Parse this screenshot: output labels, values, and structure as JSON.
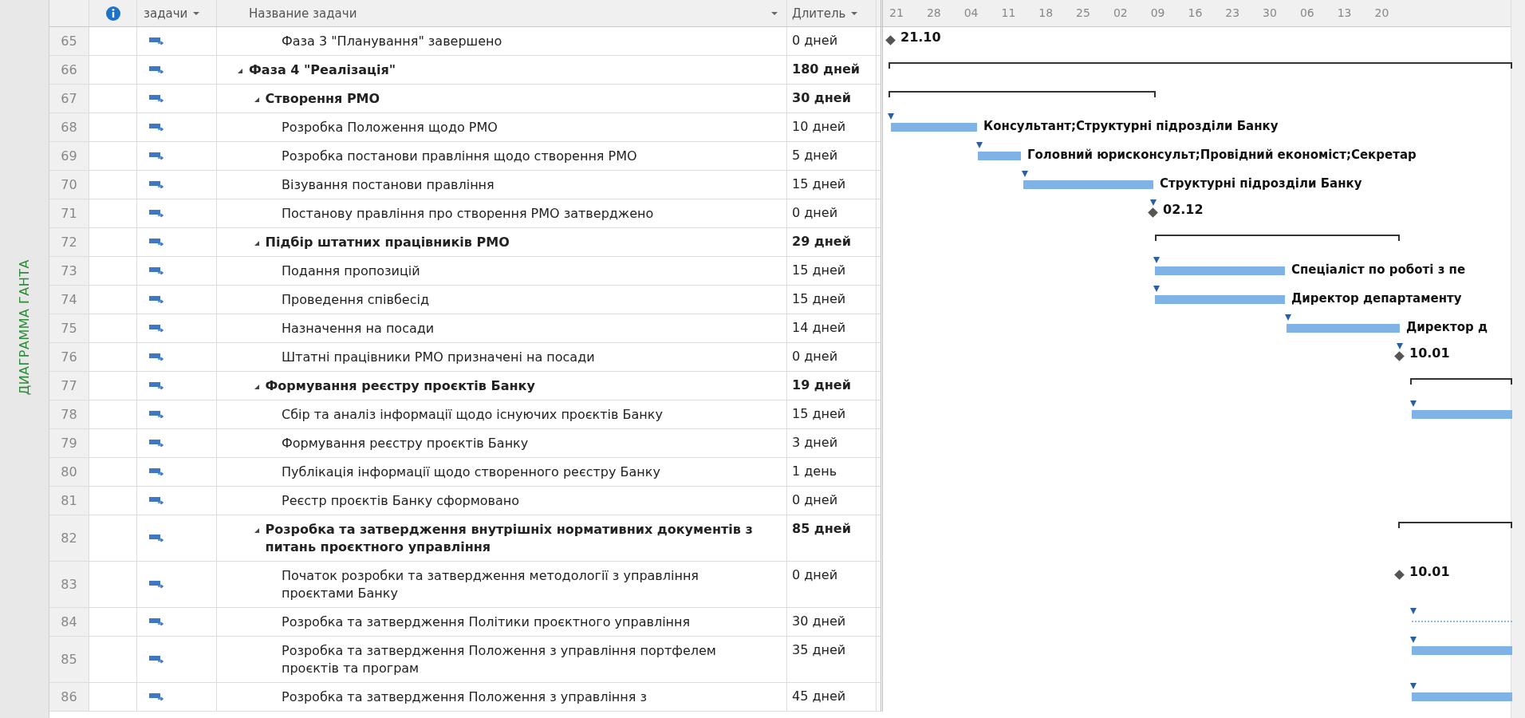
{
  "side_label": "ДИАГРАММА ГАНТА",
  "columns": {
    "mode": "задачи",
    "name": "Название задачи",
    "duration": "Длитель"
  },
  "timescale": [
    "21",
    "28",
    "04",
    "11",
    "18",
    "25",
    "02",
    "09",
    "16",
    "23",
    "30",
    "06",
    "13",
    "20"
  ],
  "tasks": [
    {
      "children": [
        {
          "children": [
            {
              "id": "65",
              "name": "Фаза 3 \"Планування\" завершено",
              "duration": "0 дней",
              "summary": false,
              "gantt": {
                "kind": "milestone",
                "label": "21.10"
              }
            }
          ]
        }
      ]
    },
    {
      "id": "66",
      "name": "Фаза 4 \"Реалізація\"",
      "duration": "180 дней",
      "summary": true,
      "expanded": true,
      "gantt": {
        "kind": "summary"
      },
      "children": [
        {
          "id": "67",
          "name": "Створення РМО",
          "duration": "30 дней",
          "summary": true,
          "expanded": true,
          "gantt": {
            "kind": "summary"
          },
          "children": [
            {
              "id": "68",
              "name": "Розробка Положення щодо РМО",
              "duration": "10 дней",
              "summary": false,
              "gantt": {
                "kind": "bar",
                "label": "Консультант;Структурні підрозділи Банку"
              }
            },
            {
              "id": "69",
              "name": "Розробка постанови правління щодо створення РМО",
              "duration": "5 дней",
              "summary": false,
              "gantt": {
                "kind": "bar",
                "label": "Головний юрисконсульт;Провідний економіст;Секретар"
              }
            },
            {
              "id": "70",
              "name": "Візування постанови правління",
              "duration": "15 дней",
              "summary": false,
              "gantt": {
                "kind": "bar",
                "label": "Структурні підрозділи Банку"
              }
            },
            {
              "id": "71",
              "name": "Постанову правління про створення РМО затверджено",
              "duration": "0 дней",
              "summary": false,
              "gantt": {
                "kind": "milestone",
                "label": "02.12"
              }
            }
          ]
        },
        {
          "id": "72",
          "name": "Підбір штатних працівників РМО",
          "duration": "29 дней",
          "summary": true,
          "expanded": true,
          "gantt": {
            "kind": "summary"
          },
          "children": [
            {
              "id": "73",
              "name": "Подання пропозицій",
              "duration": "15 дней",
              "summary": false,
              "gantt": {
                "kind": "bar",
                "label": "Спеціаліст по роботі з пе"
              }
            },
            {
              "id": "74",
              "name": "Проведення співбесід",
              "duration": "15 дней",
              "summary": false,
              "gantt": {
                "kind": "bar",
                "label": "Директор департаменту"
              }
            },
            {
              "id": "75",
              "name": "Назначення на посади",
              "duration": "14 дней",
              "summary": false,
              "gantt": {
                "kind": "bar",
                "label": "Директор д"
              }
            },
            {
              "id": "76",
              "name": "Штатні працівники РМО призначені на посади",
              "duration": "0 дней",
              "summary": false,
              "gantt": {
                "kind": "milestone",
                "label": "10.01"
              }
            }
          ]
        },
        {
          "id": "77",
          "name": "Формування реєстру проєктів Банку",
          "duration": "19 дней",
          "summary": true,
          "expanded": true,
          "gantt": {
            "kind": "summary"
          },
          "children": [
            {
              "id": "78",
              "name": "Сбір та аналіз інформації щодо існуючих проєктів Банку",
              "duration": "15 дней",
              "summary": false,
              "gantt": {
                "kind": "bar"
              }
            },
            {
              "id": "79",
              "name": "Формування реєстру проєктів Банку",
              "duration": "3 дней",
              "summary": false
            },
            {
              "id": "80",
              "name": "Публікація інформації щодо створенного реєстру Банку",
              "duration": "1 день",
              "summary": false
            },
            {
              "id": "81",
              "name": "Реєстр проєктів Банку сформовано",
              "duration": "0 дней",
              "summary": false
            }
          ]
        },
        {
          "id": "82",
          "name": "Розробка та затвердження внутрішніх нормативних документів з питань проєктного управління",
          "duration": "85 дней",
          "summary": true,
          "expanded": true,
          "gantt": {
            "kind": "summary"
          },
          "children": [
            {
              "id": "83",
              "name": "Початок розробки та затвердження методології з управління проєктами Банку",
              "duration": "0 дней",
              "summary": false,
              "gantt": {
                "kind": "milestone",
                "label": "10.01"
              }
            },
            {
              "id": "84",
              "name": "Розробка та затвердження Політики проєктного управління",
              "duration": "30 дней",
              "summary": false,
              "gantt": {
                "kind": "slack"
              }
            },
            {
              "id": "85",
              "name": "Розробка та затвердження Положення з управління портфелем проєктів та програм",
              "duration": "35 дней",
              "summary": false,
              "gantt": {
                "kind": "bar"
              }
            },
            {
              "id": "86",
              "name": "Розробка та затвердження Положення з управління з",
              "duration": "45 дней",
              "summary": false,
              "gantt": {
                "kind": "bar"
              }
            }
          ]
        }
      ]
    }
  ]
}
